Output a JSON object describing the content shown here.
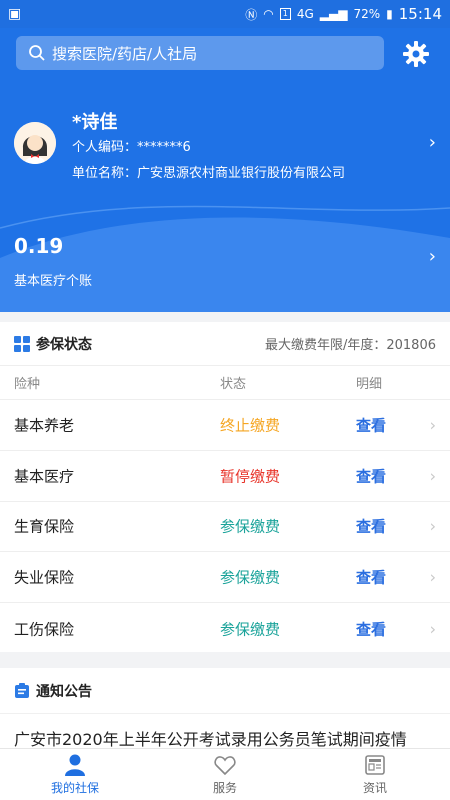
{
  "status_bar": {
    "time": "15:14",
    "battery": "72%",
    "network": "4G",
    "sim_badge": "1"
  },
  "search": {
    "placeholder": "搜索医院/药店/人社局"
  },
  "profile": {
    "name": "*诗佳",
    "personal_id_label": "个人编码：",
    "personal_id": "*******6",
    "employer_label": "单位名称：",
    "employer": "广安思源农村商业银行股份有限公司"
  },
  "account": {
    "amount": "0.19",
    "label": "基本医疗个账"
  },
  "insurance": {
    "title": "参保状态",
    "max_year_label": "最大缴费年限/年度：",
    "max_year": "201806",
    "headers": [
      "险种",
      "状态",
      "明细"
    ],
    "rows": [
      {
        "type": "基本养老",
        "status": "终止缴费",
        "status_color": "#f5a623",
        "action": "查看"
      },
      {
        "type": "基本医疗",
        "status": "暂停缴费",
        "status_color": "#e8352b",
        "action": "查看"
      },
      {
        "type": "生育保险",
        "status": "参保缴费",
        "status_color": "#1aa39a",
        "action": "查看"
      },
      {
        "type": "失业保险",
        "status": "参保缴费",
        "status_color": "#1aa39a",
        "action": "查看"
      },
      {
        "type": "工伤保险",
        "status": "参保缴费",
        "status_color": "#1aa39a",
        "action": "查看"
      }
    ]
  },
  "notice": {
    "title": "通知公告",
    "first_item": "广安市2020年上半年公开考试录用公务员笔试期间疫情"
  },
  "tabs": [
    {
      "label": "我的社保",
      "icon": "person-icon",
      "active": true
    },
    {
      "label": "服务",
      "icon": "heart-icon",
      "active": false
    },
    {
      "label": "资讯",
      "icon": "news-icon",
      "active": false
    }
  ],
  "colors": {
    "primary": "#1f72e6",
    "link": "#2c6fe0"
  }
}
